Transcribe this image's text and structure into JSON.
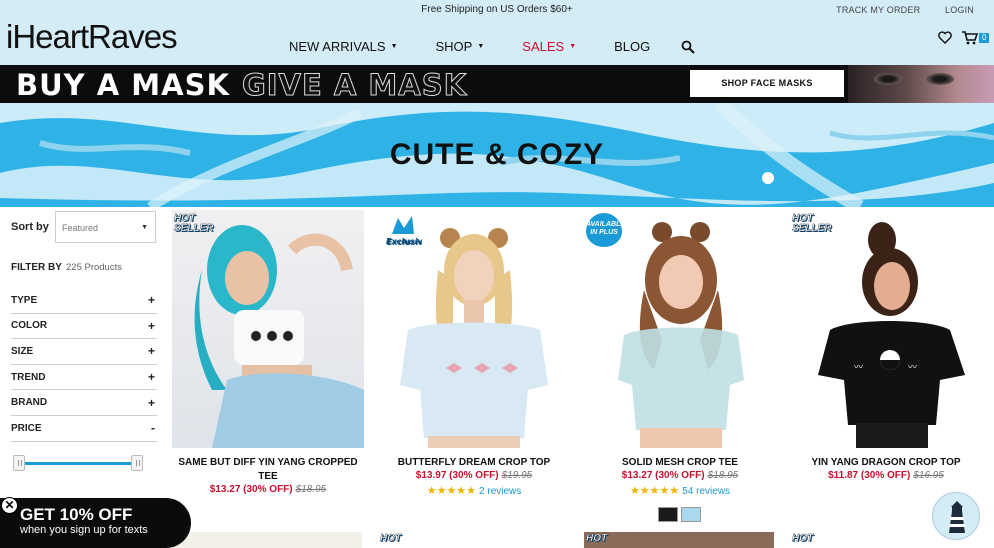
{
  "header": {
    "promo": "Free Shipping on US Orders $60+",
    "track": "TRACK MY ORDER",
    "login": "LOGIN",
    "logo": "iHeartRaves",
    "nav": [
      {
        "label": "NEW ARRIVALS"
      },
      {
        "label": "SHOP"
      },
      {
        "label": "SALES"
      },
      {
        "label": "BLOG"
      }
    ],
    "cart_count": "0"
  },
  "mask_banner": {
    "headline_buy": "BUY A MASK",
    "headline_give": "GIVE A MASK",
    "button": "SHOP FACE MASKS"
  },
  "hero": {
    "title": "CUTE & COZY"
  },
  "sidebar": {
    "sort_label": "Sort by",
    "sort_value": "Featured",
    "filter_label": "FILTER BY",
    "product_count": "225 Products",
    "facets": [
      {
        "label": "TYPE",
        "sign": "+"
      },
      {
        "label": "COLOR",
        "sign": "+"
      },
      {
        "label": "SIZE",
        "sign": "+"
      },
      {
        "label": "TREND",
        "sign": "+"
      },
      {
        "label": "BRAND",
        "sign": "+"
      },
      {
        "label": "PRICE",
        "sign": "-"
      }
    ]
  },
  "products": [
    {
      "name": "SAME BUT DIFF YIN YANG CROPPED TEE",
      "price": "$13.27 (30% OFF)",
      "original": "$18.95",
      "badge": "HOT SELLER",
      "stars": "",
      "reviews": ""
    },
    {
      "name": "BUTTERFLY DREAM CROP TOP",
      "price": "$13.97 (30% OFF)",
      "original": "$19.95",
      "badge": "EXCLUSIVE",
      "stars": "★★★★★",
      "reviews": "2 reviews"
    },
    {
      "name": "SOLID MESH CROP TEE",
      "price": "$13.27 (30% OFF)",
      "original": "$18.95",
      "badge": "AVAILABLE IN PLUS",
      "stars": "★★★★★",
      "reviews": "54 reviews"
    },
    {
      "name": "YIN YANG DRAGON CROP TOP",
      "price": "$11.87 (30% OFF)",
      "original": "$16.95",
      "badge": "HOT SELLER",
      "stars": "",
      "reviews": ""
    }
  ],
  "swatch_colors": [
    "#1a1a1a",
    "#a9d8ef"
  ],
  "popup": {
    "title": "GET 10% OFF",
    "subtitle": "when you sign up for texts",
    "close": "✕"
  },
  "colors": {
    "header_bg": "#d4ecf6",
    "accent": "#1a9ad6",
    "sale": "#c8102e"
  }
}
